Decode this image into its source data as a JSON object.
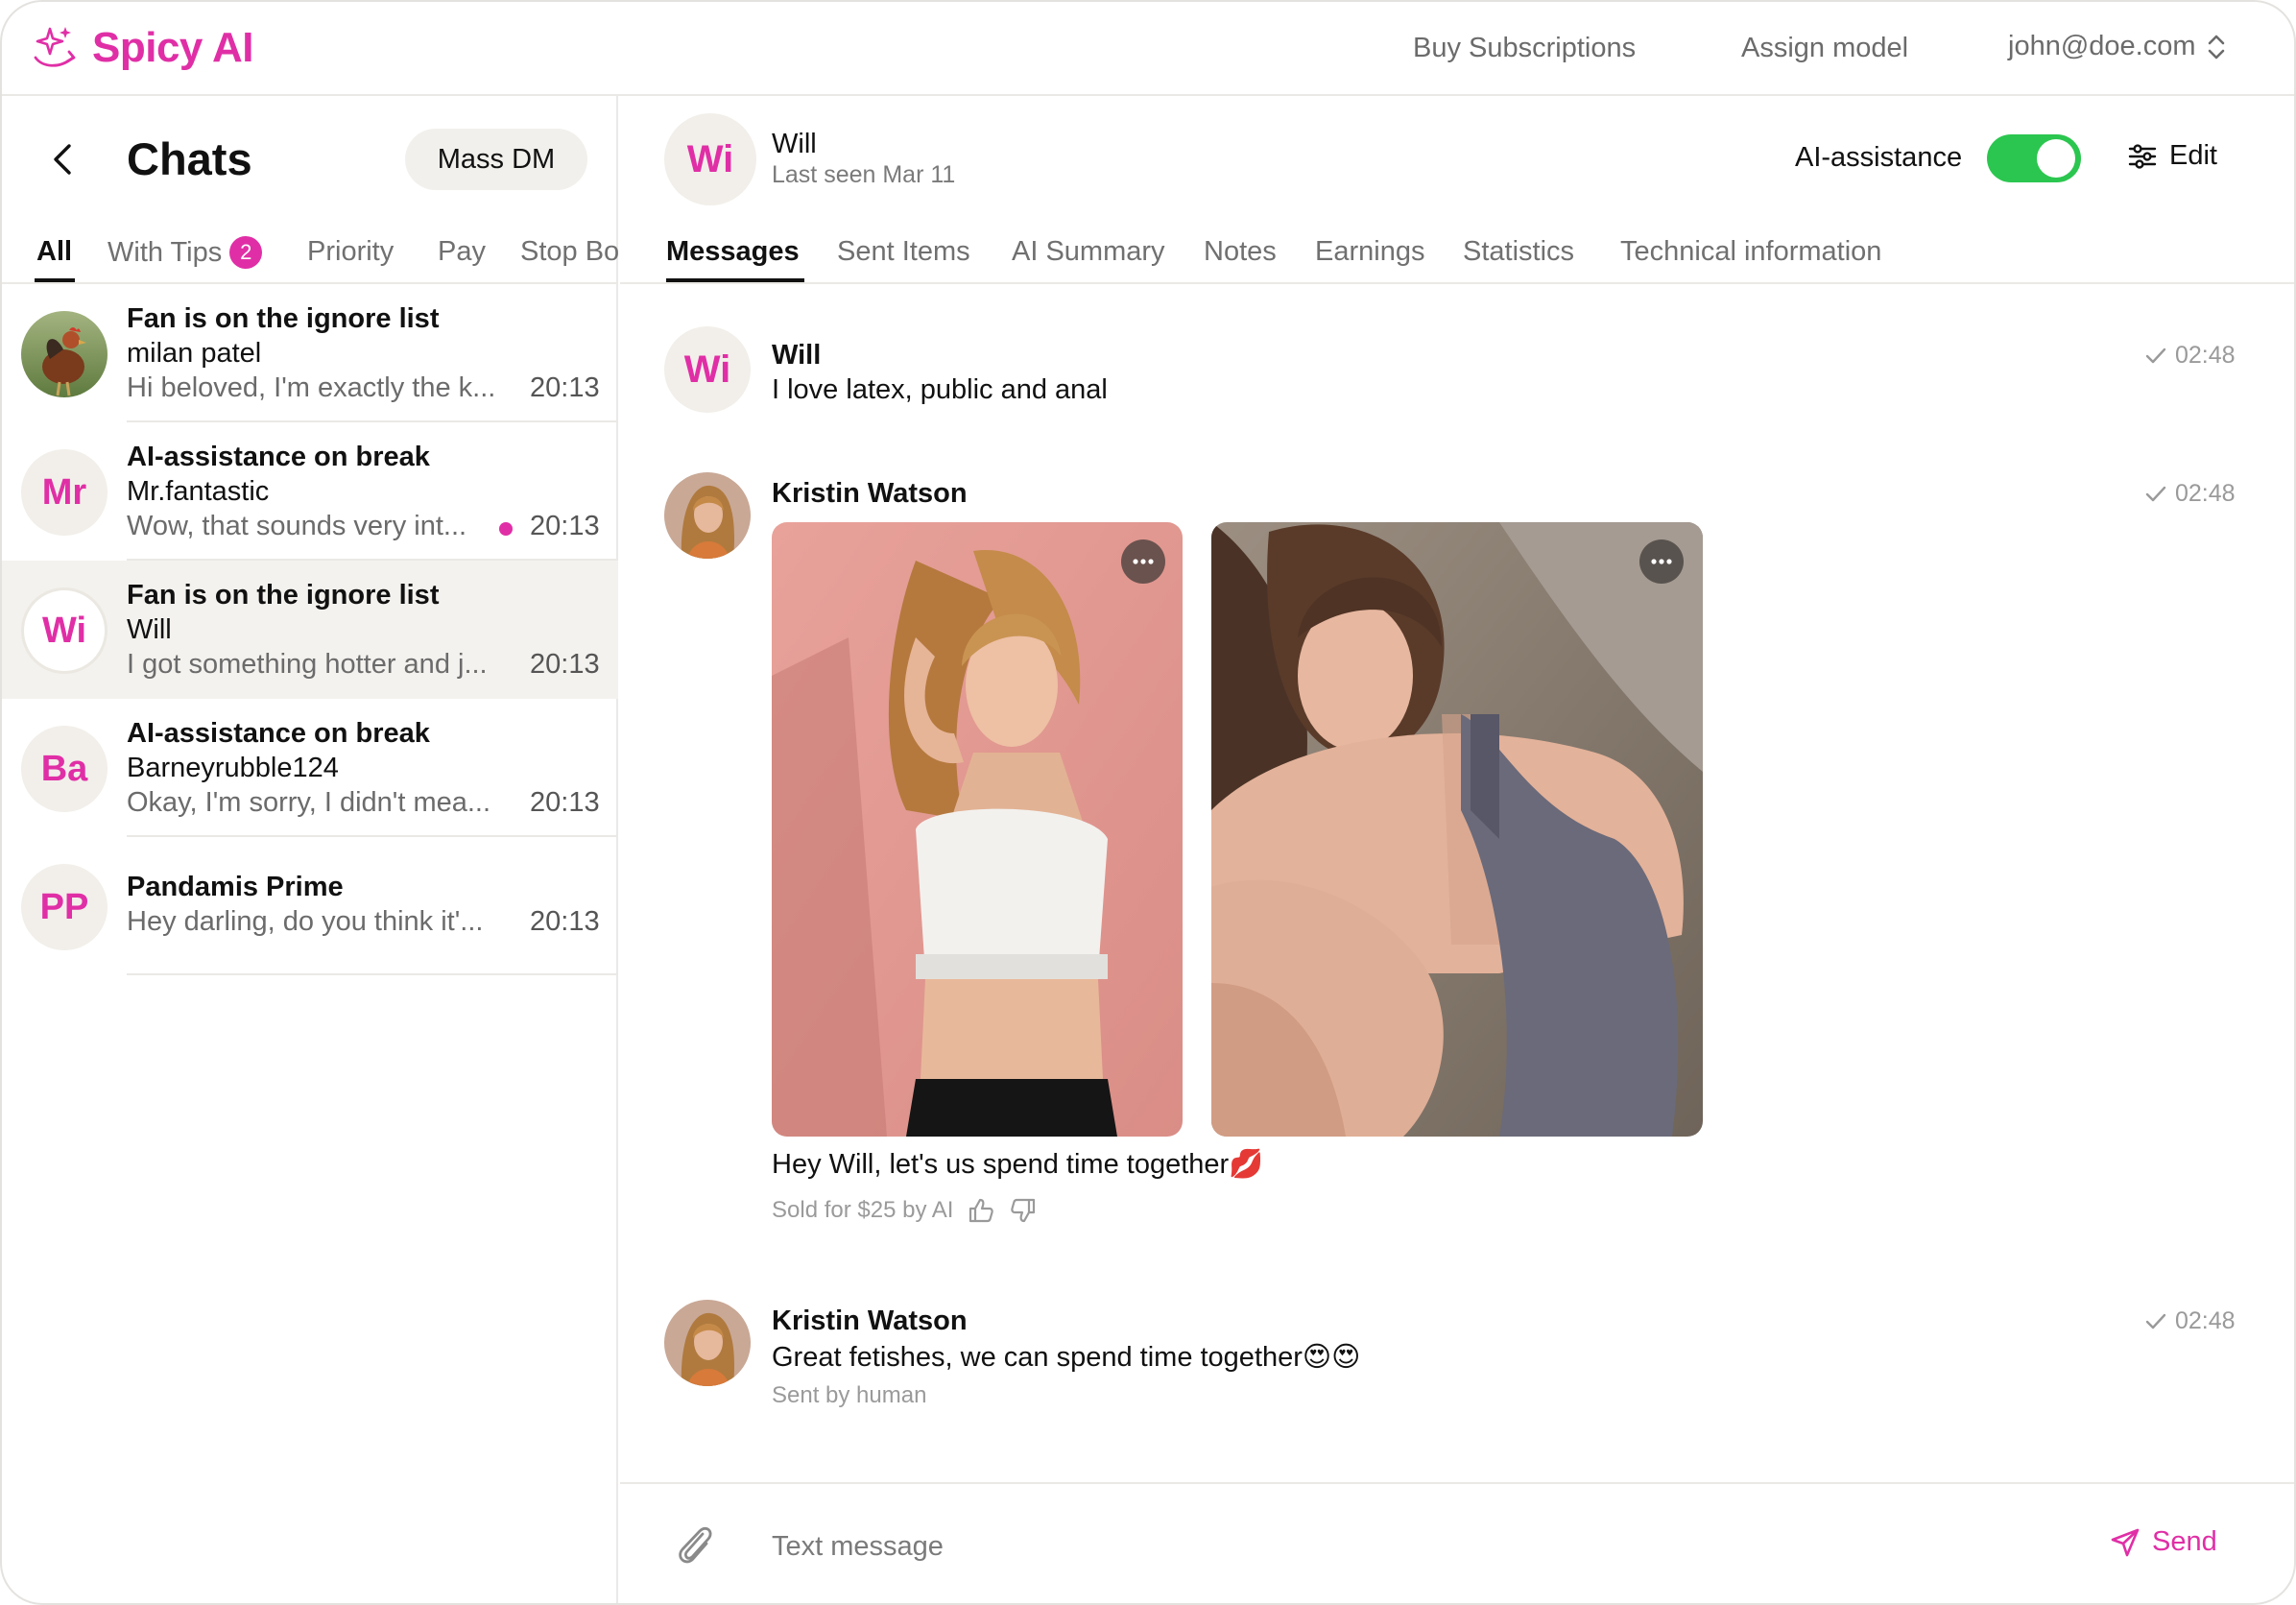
{
  "app": {
    "name": "Spicy AI",
    "accent": "#e02fa6",
    "toggle_on": "#2bc64f"
  },
  "topbar": {
    "buy_subscriptions": "Buy Subscriptions",
    "assign_model": "Assign model",
    "account": "john@doe.com"
  },
  "sidebar": {
    "title": "Chats",
    "mass_dm": "Mass DM",
    "tabs": [
      {
        "label": "All",
        "active": true
      },
      {
        "label": "With Tips",
        "badge": "2"
      },
      {
        "label": "Priority"
      },
      {
        "label": "Pay"
      },
      {
        "label": "Stop Bo"
      }
    ],
    "chats": [
      {
        "status": "Fan is on the ignore list",
        "name": "milan patel",
        "preview": "Hi beloved, I'm exactly the k...",
        "time": "20:13",
        "avatar": "photo-rooster"
      },
      {
        "status": "AI-assistance on break",
        "name": "Mr.fantastic",
        "preview": "Wow, that sounds very int...",
        "time": "20:13",
        "avatar": "Mr",
        "unread": true
      },
      {
        "status": "Fan is on the ignore list",
        "name": "Will",
        "preview": "I got something hotter and j...",
        "time": "20:13",
        "avatar": "Wi",
        "selected": true
      },
      {
        "status": "AI-assistance on break",
        "name": "Barneyrubble124",
        "preview": "Okay, I'm sorry, I didn't mea...",
        "time": "20:13",
        "avatar": "Ba"
      },
      {
        "name": "Pandamis Prime",
        "preview": "Hey darling, do you think it'...",
        "time": "20:13",
        "avatar": "PP"
      }
    ]
  },
  "conversation": {
    "avatar": "Wi",
    "name": "Will",
    "last_seen": "Last seen Mar 11",
    "ai_assistance_label": "AI-assistance",
    "ai_assistance_on": true,
    "edit_label": "Edit",
    "tabs": [
      {
        "label": "Messages",
        "active": true
      },
      {
        "label": "Sent Items"
      },
      {
        "label": "AI Summary"
      },
      {
        "label": "Notes"
      },
      {
        "label": "Earnings"
      },
      {
        "label": "Statistics"
      },
      {
        "label": "Technical information"
      }
    ],
    "messages": [
      {
        "sender": "Will",
        "avatar": "Wi",
        "text": "I love latex, public and anal",
        "time": "02:48"
      },
      {
        "sender": "Kristin Watson",
        "avatar": "photo-kristin",
        "text": "Hey Will, let's us spend time together💋",
        "time": "02:48",
        "meta": "Sold for $25 by AI",
        "photos": [
          "photo-pink-wall",
          "photo-grey-swimsuit"
        ]
      },
      {
        "sender": "Kristin Watson",
        "avatar": "photo-kristin",
        "text": "Great fetishes, we can spend time together😍😍",
        "time": "02:48",
        "meta": "Sent by human"
      }
    ],
    "composer": {
      "placeholder": "Text message",
      "send_label": "Send"
    }
  }
}
